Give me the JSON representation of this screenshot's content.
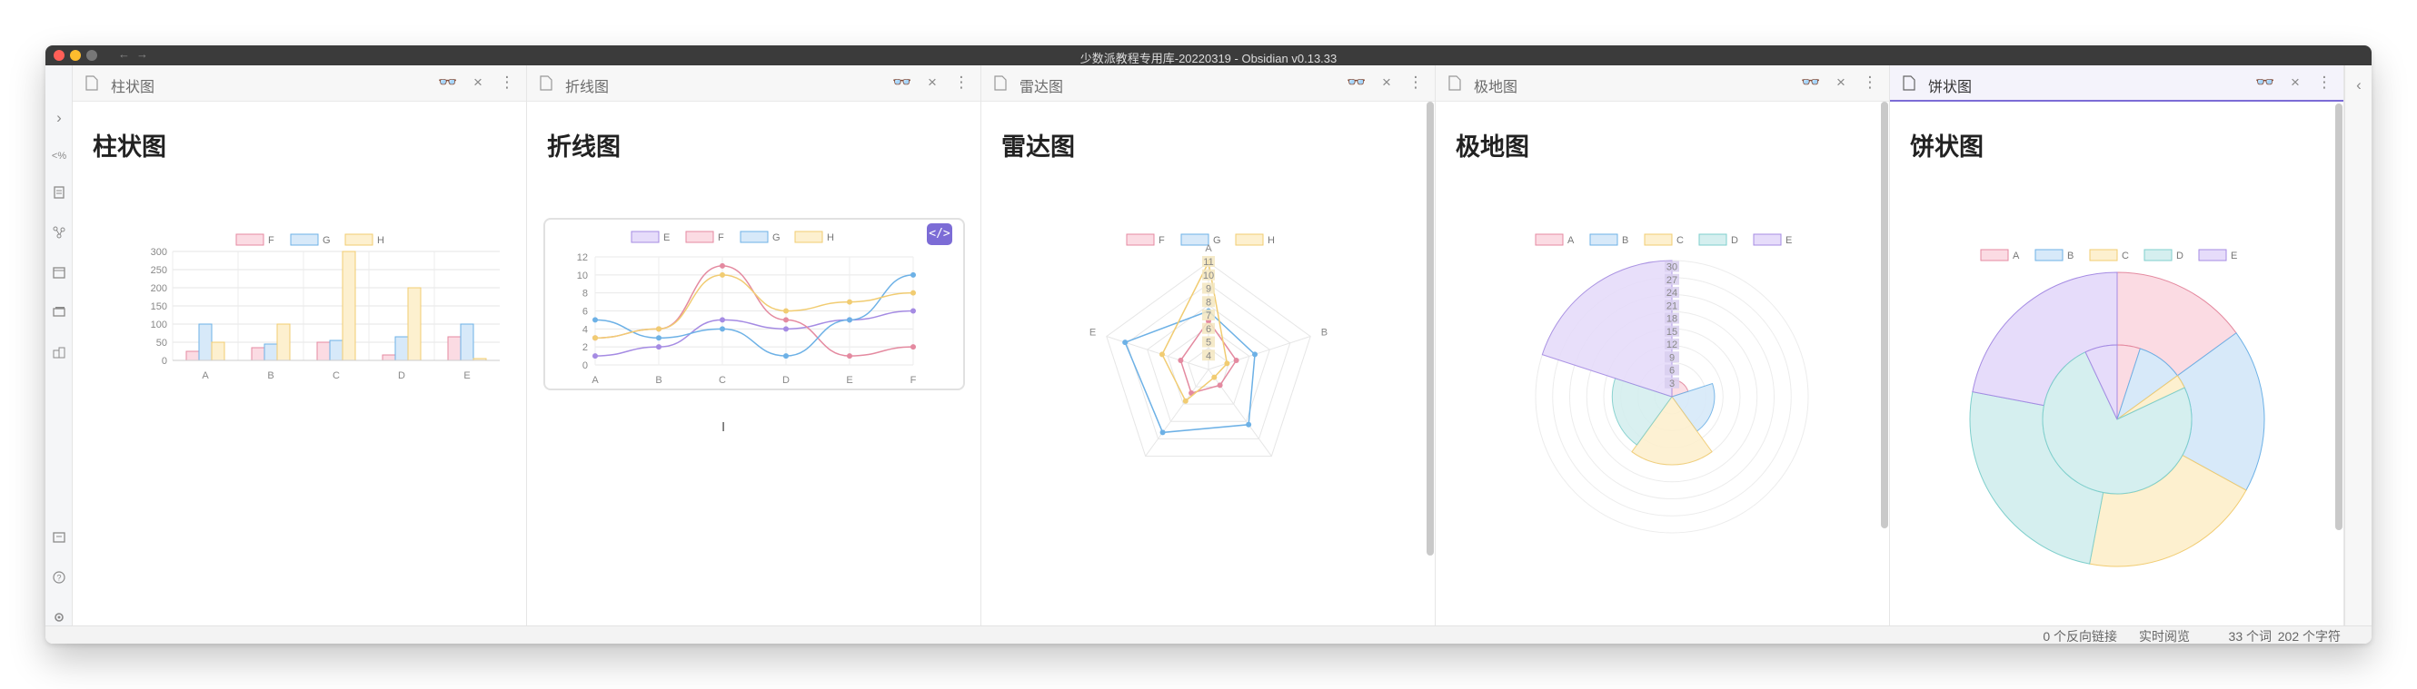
{
  "window": {
    "title": "少数派教程专用库-20220319 - Obsidian v0.13.33",
    "back": "←",
    "forward": "→"
  },
  "ribbon": {
    "icons": [
      "expand-icon",
      "template-icon",
      "note-icon",
      "graph-icon",
      "calendar-icon",
      "tag-icon",
      "gallery-icon",
      "vault-icon",
      "help-icon",
      "settings-icon"
    ],
    "expand": "›",
    "template": "<%"
  },
  "panes": [
    {
      "tab_title": "柱状图",
      "heading": "柱状图"
    },
    {
      "tab_title": "折线图",
      "heading": "折线图"
    },
    {
      "tab_title": "雷达图",
      "heading": "雷达图"
    },
    {
      "tab_title": "极地图",
      "heading": "极地图"
    },
    {
      "tab_title": "饼状图",
      "heading": "饼状图"
    }
  ],
  "pane_buttons": {
    "reading": "👓",
    "close": "×",
    "more": "⋮"
  },
  "code_button": "</>",
  "right_strip": {
    "collapse": "‹"
  },
  "status": {
    "backlinks": "0 个反向链接",
    "mode": "实时阅览",
    "words": "33 个词",
    "chars": "202 个字符"
  },
  "colors": {
    "A": {
      "fill": "#fbdbe3",
      "stroke": "#e48aa0"
    },
    "B": {
      "fill": "#d7e9f9",
      "stroke": "#6db1e6"
    },
    "C": {
      "fill": "#fdf0cf",
      "stroke": "#f1cc72"
    },
    "D": {
      "fill": "#d5efef",
      "stroke": "#7fcfcc"
    },
    "E": {
      "fill": "#e6dcfa",
      "stroke": "#a58be3"
    },
    "F": {
      "fill": "#fbdbe3",
      "stroke": "#e48aa0"
    },
    "G": {
      "fill": "#d7e9f9",
      "stroke": "#6db1e6"
    },
    "H": {
      "fill": "#fdf0cf",
      "stroke": "#f1cc72"
    },
    "accent": "#7c6cd6"
  },
  "chart_data": [
    {
      "type": "bar",
      "categories": [
        "A",
        "B",
        "C",
        "D",
        "E"
      ],
      "series": [
        {
          "name": "F",
          "values": [
            25,
            35,
            50,
            15,
            65
          ]
        },
        {
          "name": "G",
          "values": [
            100,
            45,
            55,
            65,
            100
          ]
        },
        {
          "name": "H",
          "values": [
            50,
            100,
            300,
            200,
            5
          ]
        }
      ],
      "yticks": [
        0,
        50,
        100,
        150,
        200,
        250,
        300
      ],
      "ylim": [
        0,
        300
      ],
      "legend": "top-center",
      "grid": true
    },
    {
      "type": "line",
      "categories": [
        "A",
        "B",
        "C",
        "D",
        "E",
        "F"
      ],
      "series": [
        {
          "name": "E",
          "values": [
            1,
            2,
            5,
            4,
            5,
            6
          ]
        },
        {
          "name": "F",
          "values": [
            3,
            4,
            11,
            5,
            1,
            2
          ]
        },
        {
          "name": "G",
          "values": [
            5,
            3,
            4,
            1,
            5,
            10
          ]
        },
        {
          "name": "H",
          "values": [
            3,
            4,
            10,
            6,
            7,
            8
          ]
        }
      ],
      "yticks": [
        0,
        2,
        4,
        6,
        8,
        10,
        12
      ],
      "ylim": [
        0,
        12
      ],
      "legend": "top-center",
      "grid": true
    },
    {
      "type": "radar",
      "axes": [
        "A",
        "B",
        "C",
        "D",
        "E"
      ],
      "series": [
        {
          "name": "F",
          "values": [
            5,
            3,
            2,
            3,
            3
          ]
        },
        {
          "name": "G",
          "values": [
            6,
            5,
            7,
            8,
            9
          ]
        },
        {
          "name": "H",
          "values": [
            11,
            2,
            1,
            4,
            5
          ]
        }
      ],
      "scale_labels": [
        "4",
        "5",
        "6",
        "7",
        "8",
        "9",
        "10",
        "11"
      ],
      "rmax": 11,
      "legend": "top-center"
    },
    {
      "type": "polar",
      "categories": [
        "A",
        "B",
        "C",
        "D",
        "E"
      ],
      "values": [
        10,
        25,
        40,
        35,
        80
      ],
      "scale_labels": [
        "3",
        "6",
        "9",
        "12",
        "15",
        "18",
        "21",
        "24",
        "27",
        "30"
      ],
      "rmax": 80,
      "legend": "top-center"
    },
    {
      "type": "pie",
      "categories": [
        "A",
        "B",
        "C",
        "D",
        "E"
      ],
      "outer": [
        15,
        18,
        20,
        25,
        22
      ],
      "inner": [
        5,
        10,
        3,
        75,
        7
      ],
      "legend": "top-center"
    }
  ]
}
